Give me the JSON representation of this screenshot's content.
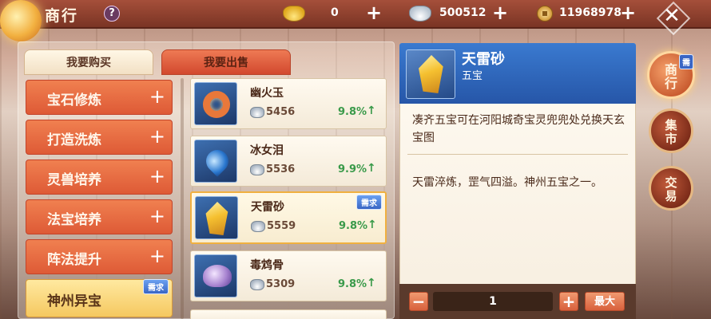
{
  "header": {
    "title": "商行",
    "help_label": "?",
    "gold_ingot": {
      "value": "0",
      "icon": "gold-ingot-icon"
    },
    "silver_ingot": {
      "value": "500512",
      "icon": "silver-ingot-icon"
    },
    "coins": {
      "value": "11968978",
      "icon": "copper-coin-icon"
    }
  },
  "tabs": [
    {
      "label": "我要购买",
      "active": true
    },
    {
      "label": "我要出售",
      "active": false
    }
  ],
  "categories": [
    {
      "label": "宝石修炼",
      "symbol": "+"
    },
    {
      "label": "打造洗炼",
      "symbol": "+"
    },
    {
      "label": "灵兽培养",
      "symbol": "+"
    },
    {
      "label": "法宝培养",
      "symbol": "+"
    },
    {
      "label": "阵法提升",
      "symbol": "+"
    },
    {
      "label": "神州异宝",
      "symbol": "",
      "badge": "需求",
      "active": true
    }
  ],
  "items": [
    {
      "name": "幽火玉",
      "price": "5456",
      "change": "9.8%",
      "arrow": "↑"
    },
    {
      "name": "冰女泪",
      "price": "5536",
      "change": "9.9%",
      "arrow": "↑"
    },
    {
      "name": "天雷砂",
      "price": "5559",
      "change": "9.8%",
      "arrow": "↑",
      "badge": "需求",
      "selected": true
    },
    {
      "name": "毒鸩骨",
      "price": "5309",
      "change": "9.8%",
      "arrow": "↑"
    }
  ],
  "detail": {
    "name": "天雷砂",
    "subtitle": "五宝",
    "description": "凑齐五宝可在河阳城奇宝灵兜兜处兑换天玄宝图",
    "flavor": "天雷淬炼，罡气四溢。神州五宝之一。",
    "quantity": "1",
    "minus_label": "−",
    "plus_label": "+",
    "max_label": "最大"
  },
  "side_nav": [
    {
      "label": "商行",
      "badge": "需",
      "active": true
    },
    {
      "label": "集市",
      "active": false
    },
    {
      "label": "交易",
      "active": false
    }
  ],
  "colors": {
    "accent": "#de5a36",
    "up": "#3a9a4a",
    "badge": "#3a66c4"
  }
}
